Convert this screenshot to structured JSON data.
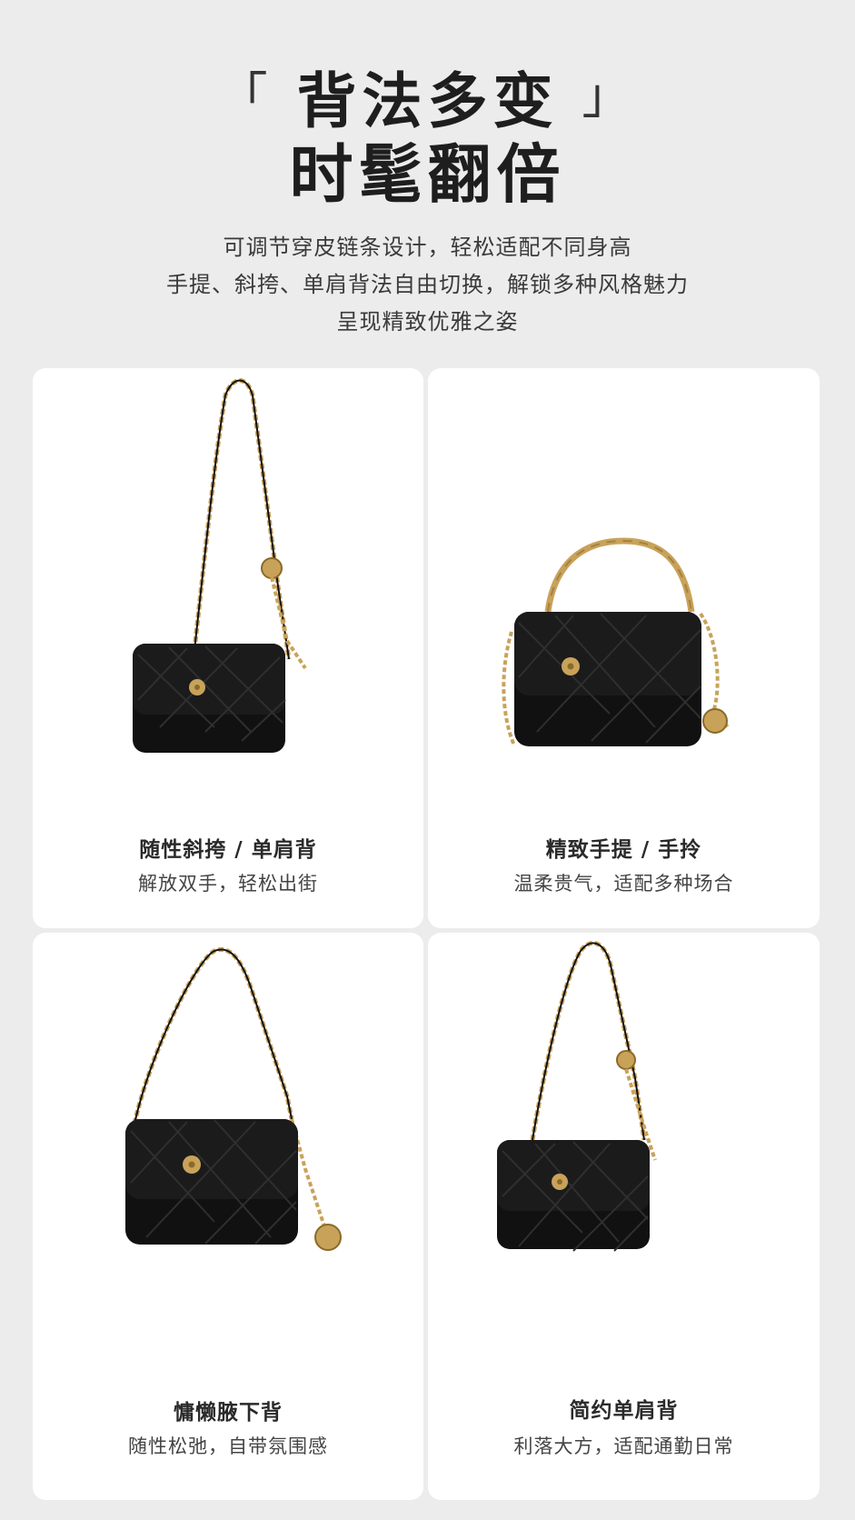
{
  "header": {
    "bracket_open": "「",
    "title_main": "背法多变",
    "bracket_close": "」",
    "title_second": "时髦翻倍",
    "desc_lines": [
      "可调节穿皮链条设计，轻松适配不同身高",
      "手提、斜挎、单肩背法自由切换，解锁多种风格魅力",
      "呈现精致优雅之姿"
    ]
  },
  "cards": [
    {
      "title": "随性斜挎 / 单肩背",
      "subtitle": "解放双手，轻松出街"
    },
    {
      "title": "精致手提 / 手拎",
      "subtitle": "温柔贵气，适配多种场合"
    },
    {
      "title": "慵懒腋下背",
      "subtitle": "随性松弛，自带氛围感"
    },
    {
      "title": "简约单肩背",
      "subtitle": "利落大方，适配通勤日常"
    }
  ],
  "colors": {
    "background": "#ececec",
    "card": "#ffffff",
    "bag": "#111111",
    "gold": "#c9a25a"
  }
}
